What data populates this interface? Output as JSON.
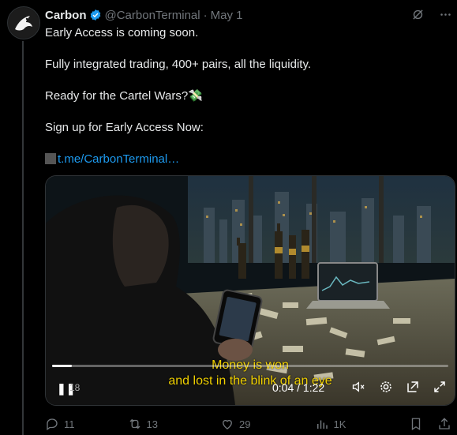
{
  "author": {
    "name": "Carbon",
    "handle": "@CarbonTerminal",
    "date": "May 1"
  },
  "body": {
    "line1": "Early Access is coming soon.",
    "line2": "Fully integrated trading, 400+ pairs, all the liquidity.",
    "line3": "Ready for the Cartel Wars?",
    "line3_emoji": "💸",
    "line4": "Sign up for Early Access Now:",
    "link": "t.me/CarbonTerminal…"
  },
  "video": {
    "subtitle1": "Money is won",
    "subtitle2": "and lost in the blink of an eye",
    "time": "0:04 / 1:22",
    "skip": "18",
    "progress": 0.05
  },
  "actions": {
    "replies": "11",
    "reposts": "13",
    "likes": "29",
    "views": "1K"
  },
  "colors": {
    "accent": "#1d9bf0",
    "subtitle": "#f0d000",
    "muted": "#71767b"
  }
}
